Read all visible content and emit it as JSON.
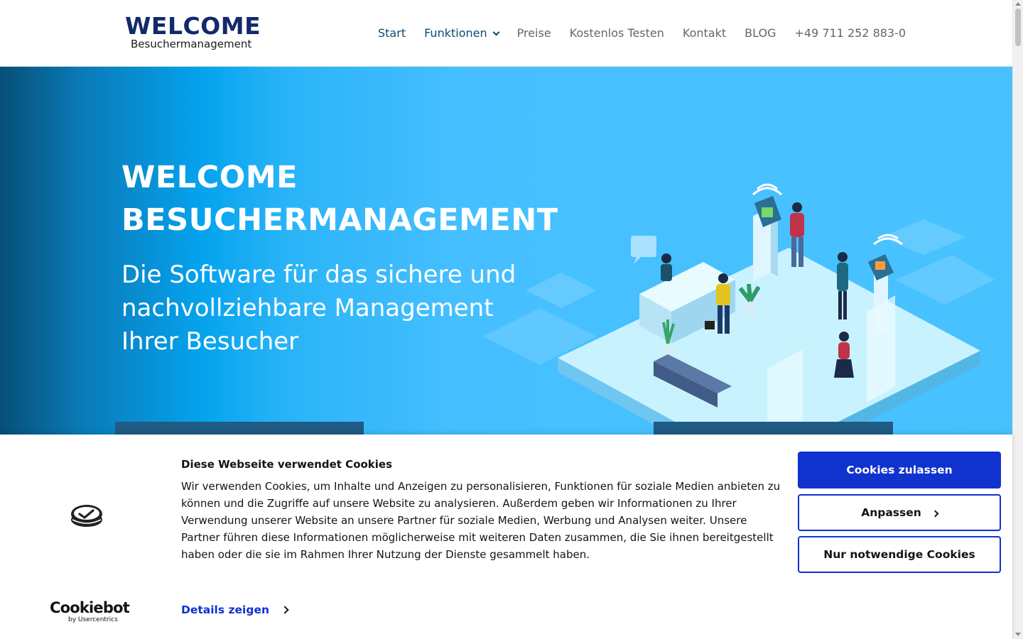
{
  "header": {
    "logo": {
      "main": "WELCOME",
      "sub": "Besuchermanagement"
    },
    "nav": [
      {
        "label": "Start"
      },
      {
        "label": "Funktionen"
      },
      {
        "label": "Preise"
      },
      {
        "label": "Kostenlos Testen"
      },
      {
        "label": "Kontakt"
      },
      {
        "label": "BLOG"
      },
      {
        "label": "+49 711 252 883-0"
      }
    ]
  },
  "hero": {
    "title_line1": "WELCOME",
    "title_line2": "BESUCHERMANAGEMENT",
    "subtitle": "Die Software für das sichere und nachvollziehbare Management Ihrer Besucher"
  },
  "cookie_banner": {
    "title": "Diese Webseite verwendet Cookies",
    "text": "Wir verwenden Cookies, um Inhalte und Anzeigen zu personalisieren, Funktionen für soziale Medien anbieten zu können und die Zugriffe auf unsere Website zu analysieren. Außerdem geben wir Informationen zu Ihrer Verwendung unserer Website an unsere Partner für soziale Medien, Werbung und Analysen weiter. Unsere Partner führen diese Informationen möglicherweise mit weiteren Daten zusammen, die Sie ihnen bereitgestellt haben oder die sie im Rahmen Ihrer Nutzung der Dienste gesammelt haben.",
    "details_link": "Details zeigen",
    "buttons": {
      "allow_all": "Cookies zulassen",
      "customize": "Anpassen",
      "necessary_only": "Nur notwendige Cookies"
    },
    "brand": {
      "main": "Cookiebot",
      "sub": "by Usercentrics"
    }
  },
  "colors": {
    "brand_navy": "#13296b",
    "nav_active": "#0c4b6e",
    "hero_blue": "#48c2ff",
    "cookie_button_blue": "#1032cf"
  }
}
